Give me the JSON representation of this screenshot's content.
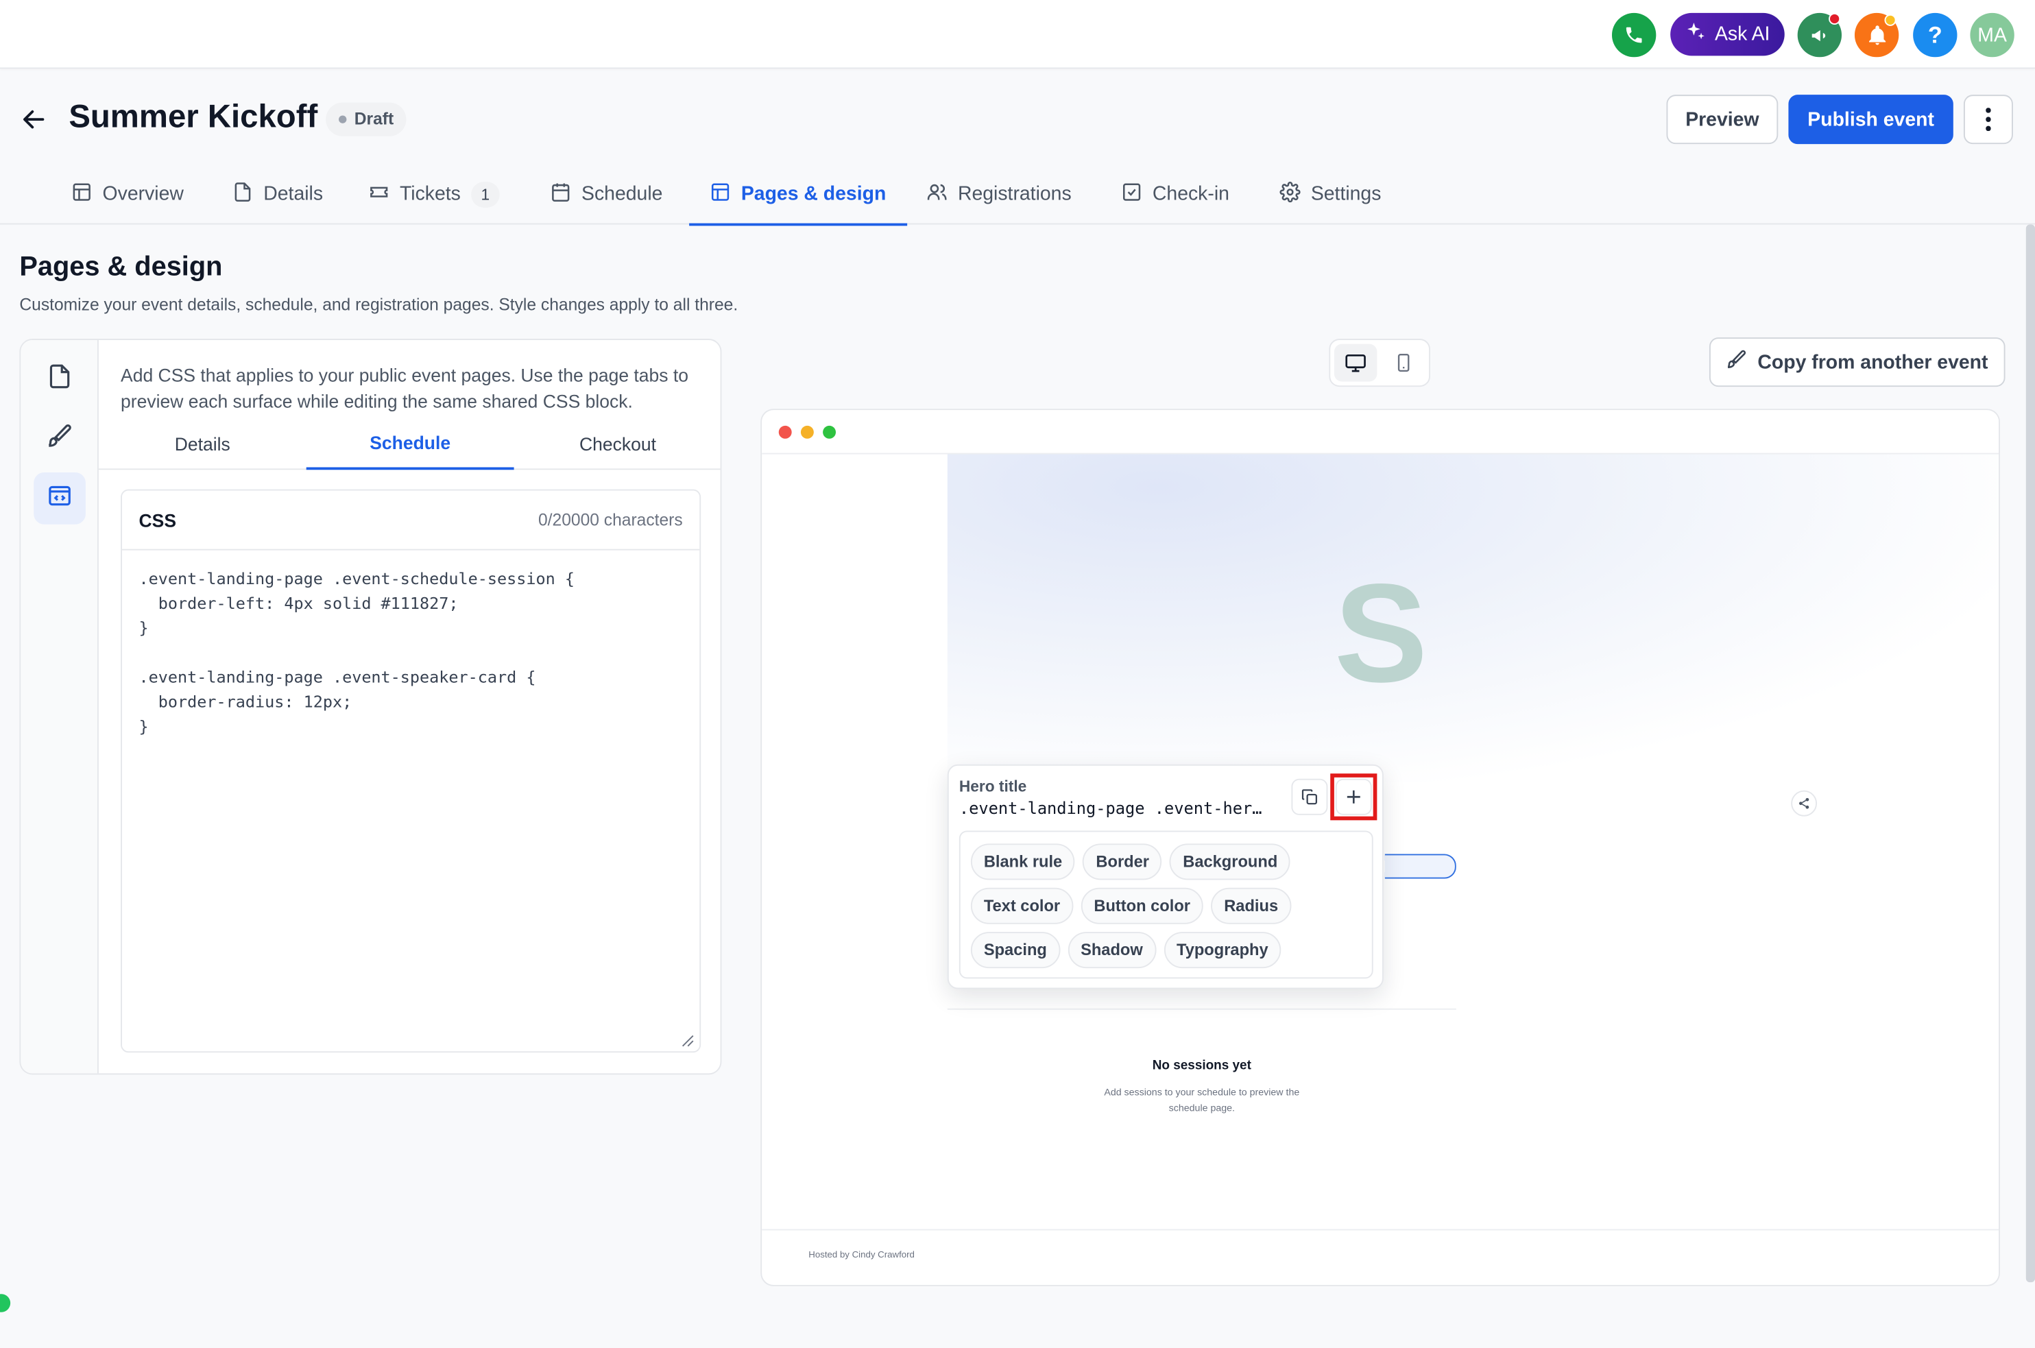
{
  "topbar": {
    "ask_ai_label": "Ask AI",
    "avatar_initials": "MA",
    "help_glyph": "?",
    "colors": {
      "phone": "#16a34a",
      "ask_ai": "#4c1d95",
      "announce": "#2f8f5b",
      "bell": "#f97316",
      "help": "#1a8cf0",
      "avatar": "#86c99a"
    }
  },
  "header": {
    "title": "Summer Kickoff",
    "status": "Draft",
    "preview_label": "Preview",
    "publish_label": "Publish event"
  },
  "tabs": [
    {
      "label": "Overview",
      "icon": "layout-icon"
    },
    {
      "label": "Details",
      "icon": "file-icon"
    },
    {
      "label": "Tickets",
      "icon": "ticket-icon",
      "badge": "1"
    },
    {
      "label": "Schedule",
      "icon": "calendar-icon"
    },
    {
      "label": "Pages & design",
      "icon": "layout-icon",
      "active": true
    },
    {
      "label": "Registrations",
      "icon": "users-icon"
    },
    {
      "label": "Check-in",
      "icon": "checkbox-icon"
    },
    {
      "label": "Settings",
      "icon": "gear-icon"
    }
  ],
  "page": {
    "title": "Pages & design",
    "subtitle": "Customize your event details, schedule, and registration pages. Style changes apply to all three."
  },
  "editor": {
    "note": "Add CSS that applies to your public event pages. Use the page tabs to preview each surface while editing the same shared CSS block.",
    "subtabs": [
      "Details",
      "Schedule",
      "Checkout"
    ],
    "active_subtab": "Schedule",
    "css_label": "CSS",
    "char_count": "0/20000 characters",
    "code": ".event-landing-page .event-schedule-session {\n  border-left: 4px solid #111827;\n}\n\n.event-landing-page .event-speaker-card {\n  border-radius: 12px;\n}"
  },
  "preview": {
    "copy_label": "Copy from another event",
    "hero_letter": "S",
    "empty_title": "No sessions yet",
    "empty_sub": "Add sessions to your schedule to preview the schedule page.",
    "hosted_by": "Hosted by Cindy Crawford"
  },
  "popover": {
    "label": "Hero title",
    "selector": ".event-landing-page .event-her…",
    "chips": [
      "Blank rule",
      "Border",
      "Background",
      "Text color",
      "Button color",
      "Radius",
      "Spacing",
      "Shadow",
      "Typography"
    ]
  }
}
